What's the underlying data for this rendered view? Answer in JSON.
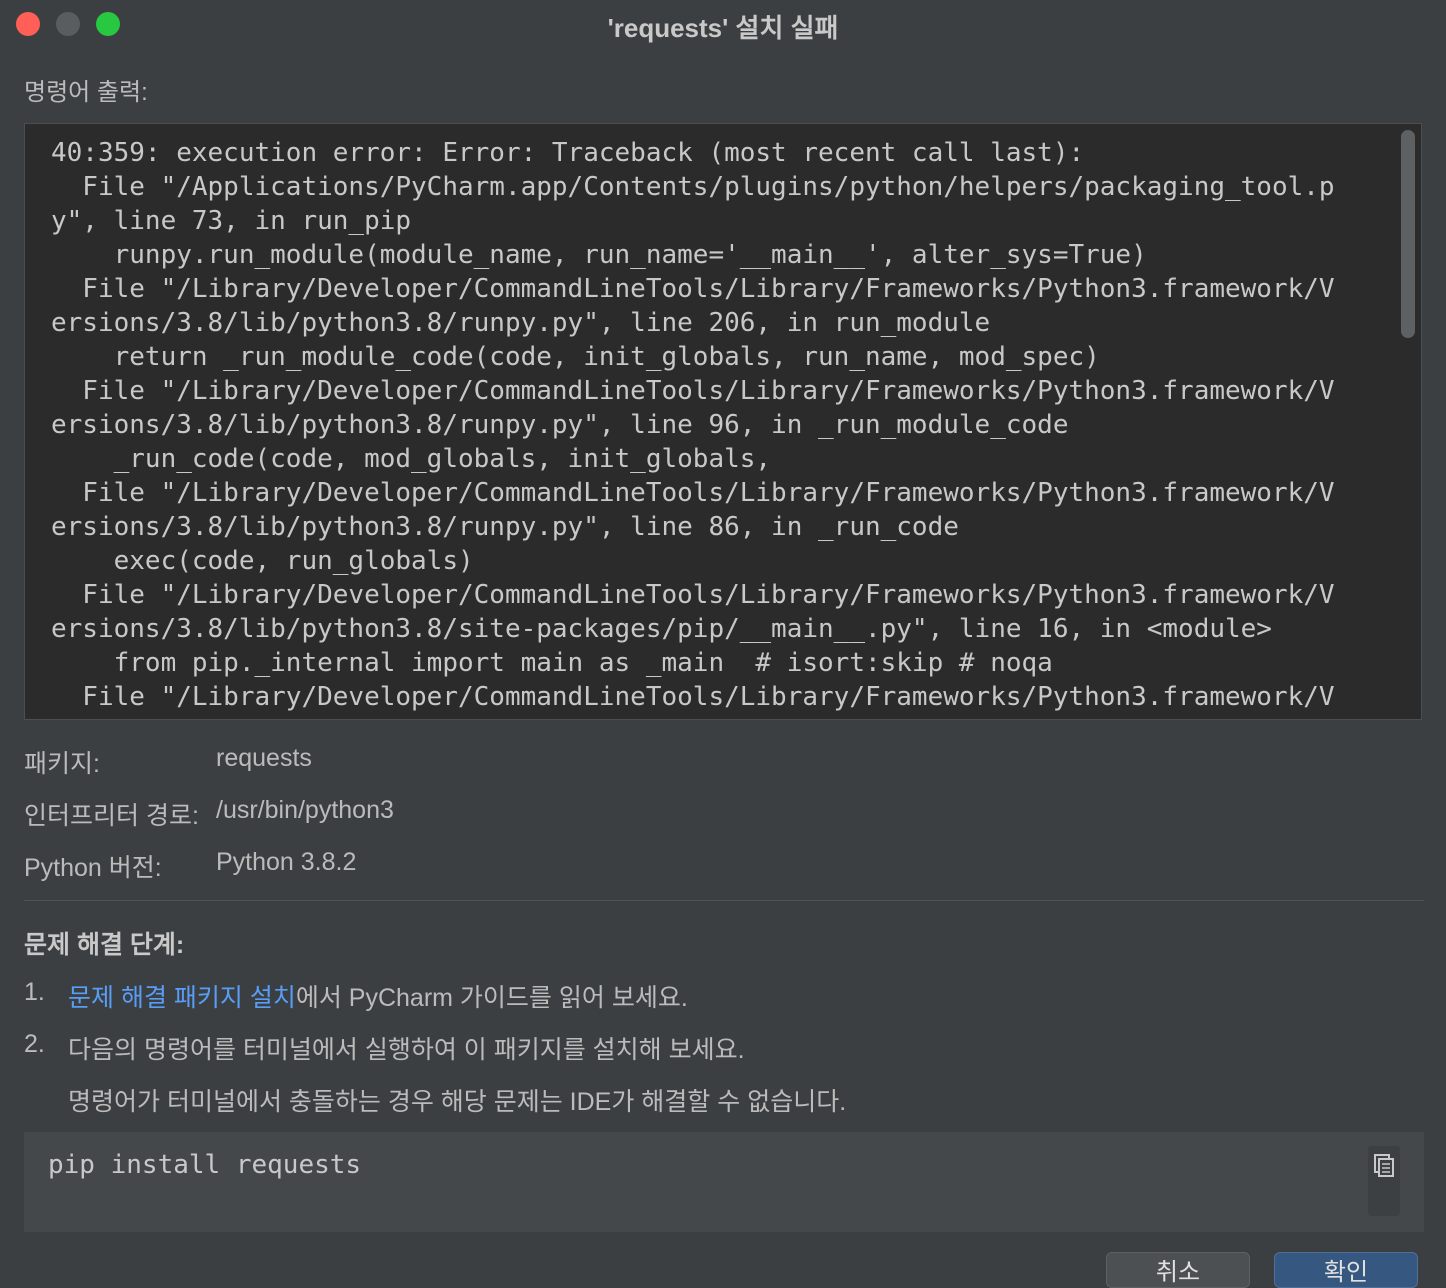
{
  "window": {
    "title": "'requests' 설치 실패"
  },
  "output": {
    "label": "명령어 출력:",
    "text": "40:359: execution error: Error: Traceback (most recent call last):\n  File \"/Applications/PyCharm.app/Contents/plugins/python/helpers/packaging_tool.p\ny\", line 73, in run_pip\n    runpy.run_module(module_name, run_name='__main__', alter_sys=True)\n  File \"/Library/Developer/CommandLineTools/Library/Frameworks/Python3.framework/V\nersions/3.8/lib/python3.8/runpy.py\", line 206, in run_module\n    return _run_module_code(code, init_globals, run_name, mod_spec)\n  File \"/Library/Developer/CommandLineTools/Library/Frameworks/Python3.framework/V\nersions/3.8/lib/python3.8/runpy.py\", line 96, in _run_module_code\n    _run_code(code, mod_globals, init_globals,\n  File \"/Library/Developer/CommandLineTools/Library/Frameworks/Python3.framework/V\nersions/3.8/lib/python3.8/runpy.py\", line 86, in _run_code\n    exec(code, run_globals)\n  File \"/Library/Developer/CommandLineTools/Library/Frameworks/Python3.framework/V\nersions/3.8/lib/python3.8/site-packages/pip/__main__.py\", line 16, in <module>\n    from pip._internal import main as _main  # isort:skip # noqa\n  File \"/Library/Developer/CommandLineTools/Library/Frameworks/Python3.framework/V"
  },
  "info": {
    "package_label": "패키지:",
    "package_value": "requests",
    "interpreter_label": "인터프리터 경로:",
    "interpreter_value": "/usr/bin/python3",
    "version_label": "Python 버전:",
    "version_value": "Python 3.8.2"
  },
  "troubleshooting": {
    "title": "문제 해결 단계:",
    "step1_num": "1.",
    "step1_link": "문제 해결 패키지 설치",
    "step1_text": "에서 PyCharm 가이드를 읽어 보세요.",
    "step2_num": "2.",
    "step2_text": "다음의 명령어를 터미널에서 실행하여 이 패키지를 설치해 보세요.",
    "step2_note": "명령어가 터미널에서 충돌하는 경우 해당 문제는 IDE가 해결할 수 없습니다."
  },
  "command": {
    "text": "pip install requests",
    "copy_icon": "copy-icon"
  },
  "buttons": {
    "cancel_label": "취소",
    "ok_label": "확인"
  },
  "colors": {
    "background": "#3c3f41",
    "output_background": "#2b2b2b",
    "link": "#589df6",
    "primary_button": "#365880"
  }
}
